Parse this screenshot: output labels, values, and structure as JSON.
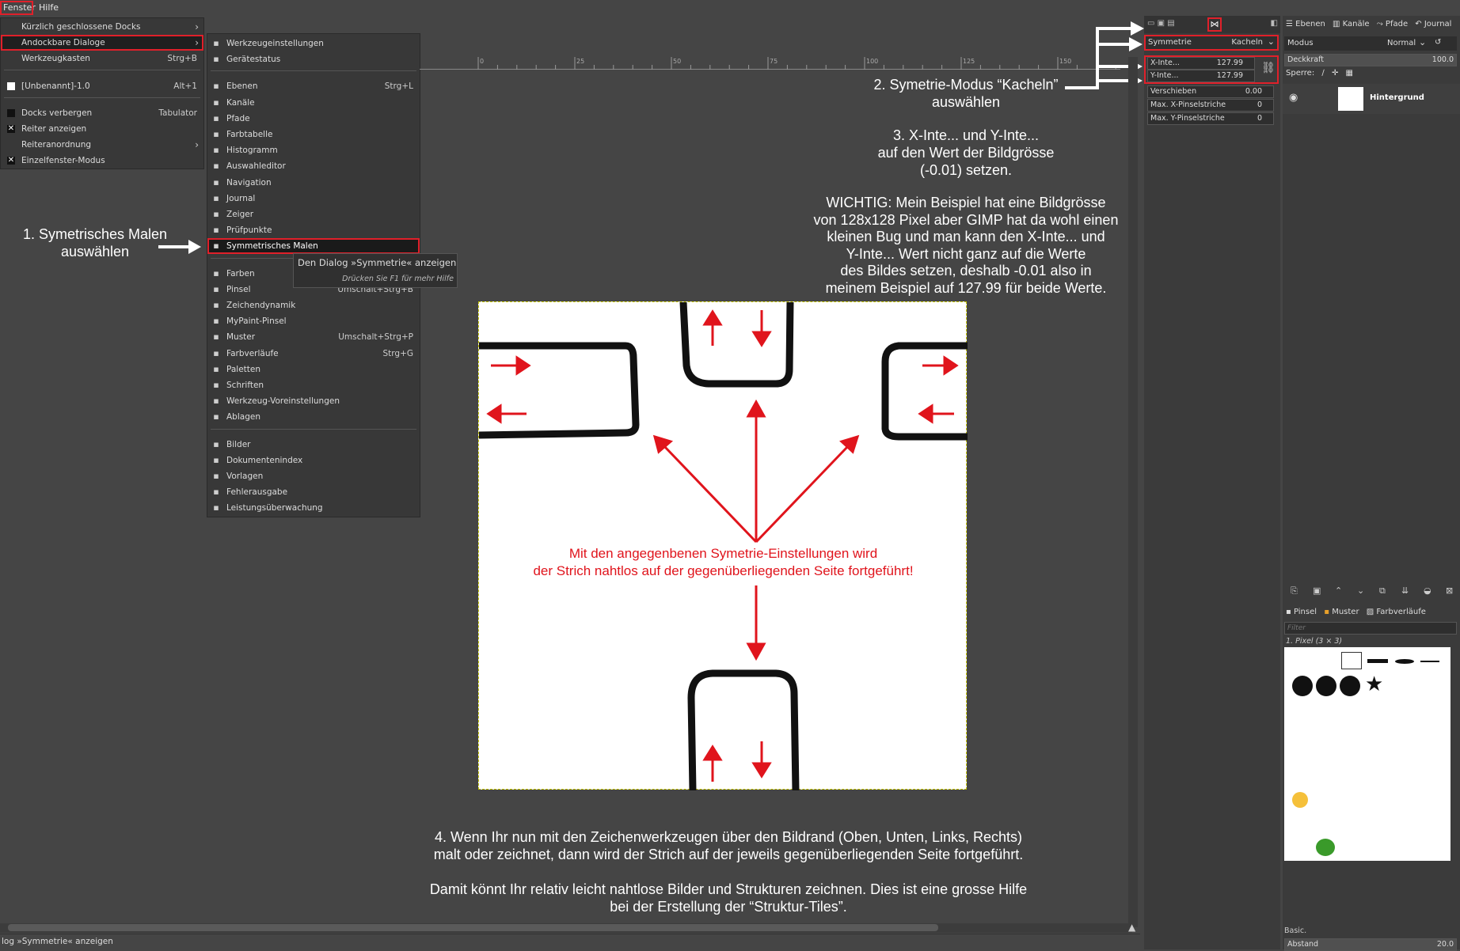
{
  "menubar": {
    "items": [
      "Fenster",
      "Hilfe"
    ]
  },
  "menu_fenster": {
    "items": [
      {
        "label": "Kürzlich geschlossene Docks",
        "shortcut": "",
        "submenu": true
      },
      {
        "label": "Andockbare Dialoge",
        "shortcut": "",
        "submenu": true
      },
      {
        "label": "Werkzeugkasten",
        "shortcut": "Strg+B"
      },
      {
        "label": "[Unbenannt]-1.0",
        "shortcut": "Alt+1"
      },
      {
        "label": "Docks verbergen",
        "shortcut": "Tabulator"
      },
      {
        "label": "Reiter anzeigen",
        "shortcut": ""
      },
      {
        "label": "Reiteranordnung",
        "shortcut": "",
        "submenu": true
      },
      {
        "label": "Einzelfenster-Modus",
        "shortcut": ""
      }
    ]
  },
  "menu_dialoge": {
    "groups": [
      [
        {
          "label": "Werkzeugeinstellungen",
          "shortcut": "",
          "icon": "tool-options-icon"
        },
        {
          "label": "Gerätestatus",
          "shortcut": "",
          "icon": "device-status-icon"
        }
      ],
      [
        {
          "label": "Ebenen",
          "shortcut": "Strg+L",
          "icon": "layers-icon"
        },
        {
          "label": "Kanäle",
          "shortcut": "",
          "icon": "channels-icon"
        },
        {
          "label": "Pfade",
          "shortcut": "",
          "icon": "paths-icon"
        },
        {
          "label": "Farbtabelle",
          "shortcut": "",
          "icon": "colormap-icon"
        },
        {
          "label": "Histogramm",
          "shortcut": "",
          "icon": "histogram-icon"
        },
        {
          "label": "Auswahleditor",
          "shortcut": "",
          "icon": "selection-editor-icon"
        },
        {
          "label": "Navigation",
          "shortcut": "",
          "icon": "navigation-icon"
        },
        {
          "label": "Journal",
          "shortcut": "",
          "icon": "journal-icon"
        },
        {
          "label": "Zeiger",
          "shortcut": "",
          "icon": "pointer-icon"
        },
        {
          "label": "Prüfpunkte",
          "shortcut": "",
          "icon": "sample-points-icon"
        },
        {
          "label": "Symmetrisches Malen",
          "shortcut": "",
          "icon": "symmetry-icon"
        }
      ],
      [
        {
          "label": "Farben",
          "shortcut": "",
          "icon": "colors-icon"
        },
        {
          "label": "Pinsel",
          "shortcut": "Umschalt+Strg+B",
          "icon": "brush-icon"
        },
        {
          "label": "Zeichendynamik",
          "shortcut": "",
          "icon": "dynamics-icon"
        },
        {
          "label": "MyPaint-Pinsel",
          "shortcut": "",
          "icon": "mypaint-brush-icon"
        },
        {
          "label": "Muster",
          "shortcut": "Umschalt+Strg+P",
          "icon": "pattern-icon"
        },
        {
          "label": "Farbverläufe",
          "shortcut": "Strg+G",
          "icon": "gradient-icon"
        },
        {
          "label": "Paletten",
          "shortcut": "",
          "icon": "palette-icon"
        },
        {
          "label": "Schriften",
          "shortcut": "",
          "icon": "fonts-icon"
        },
        {
          "label": "Werkzeug-Voreinstellungen",
          "shortcut": "",
          "icon": "tool-presets-icon"
        },
        {
          "label": "Ablagen",
          "shortcut": "",
          "icon": "buffers-icon"
        }
      ],
      [
        {
          "label": "Bilder",
          "shortcut": "",
          "icon": "images-icon"
        },
        {
          "label": "Dokumentenindex",
          "shortcut": "",
          "icon": "document-history-icon"
        },
        {
          "label": "Vorlagen",
          "shortcut": "",
          "icon": "templates-icon"
        },
        {
          "label": "Fehlerausgabe",
          "shortcut": "",
          "icon": "error-console-icon"
        },
        {
          "label": "Leistungsüberwachung",
          "shortcut": "",
          "icon": "dashboard-icon"
        }
      ]
    ]
  },
  "tooltip": {
    "title": "Den Dialog »Symmetrie« anzeigen",
    "hint": "Drücken Sie F1 für mehr Hilfe"
  },
  "ruler": {
    "ticks": [
      "0",
      "25",
      "50",
      "75",
      "100",
      "125",
      "150"
    ]
  },
  "annotations": {
    "step1": [
      "1. Symetrisches Malen",
      "auswählen"
    ],
    "step2": [
      "2. Symetrie-Modus “Kacheln”",
      "auswählen"
    ],
    "step3": [
      "3. X-Inte... und Y-Inte...",
      "auf den Wert der Bildgrösse",
      "(-0.01) setzen."
    ],
    "wichtig": [
      "WICHTIG: Mein Beispiel hat eine Bildgrösse",
      "von 128x128 Pixel aber GIMP hat da wohl einen",
      "kleinen Bug und man kann den X-Inte... und",
      "Y-Inte... Wert nicht ganz auf die Werte",
      "des Bildes setzen, deshalb -0.01 also in",
      "meinem Beispiel auf 127.99 für beide Werte."
    ],
    "canvas_red": [
      "Mit den angegenbenen Symetrie-Einstellungen wird",
      "der Strich nahtlos auf der gegenüberliegenden Seite fortgeführt!"
    ],
    "step4": [
      "4. Wenn Ihr nun mit den Zeichenwerkzeugen über den Bildrand (Oben, Unten, Links, Rechts)",
      "malt oder zeichnet, dann wird der Strich auf der jeweils gegenüberliegenden Seite fortgeführt."
    ],
    "final": [
      "Damit könnt Ihr relativ leicht nahtlose Bilder und Strukturen zeichnen. Dies ist eine grosse Hilfe",
      "bei der Erstellung der “Struktur-Tiles”."
    ]
  },
  "statusbar": {
    "text": "log »Symmetrie« anzeigen"
  },
  "symmetry_dock": {
    "mode_label": "Symmetrie",
    "mode_value": "Kacheln",
    "fields": [
      {
        "label": "X-Inte...",
        "value": "127.99"
      },
      {
        "label": "Y-Inte...",
        "value": "127.99"
      },
      {
        "label": "Verschieben",
        "value": "0.00"
      },
      {
        "label": "Max. X-Pinselstriche",
        "value": "0"
      },
      {
        "label": "Max. Y-Pinselstriche",
        "value": "0"
      }
    ]
  },
  "layers_dock": {
    "tabs": [
      "Ebenen",
      "Kanäle",
      "Pfade",
      "Journal"
    ],
    "mode_label": "Modus",
    "mode_value": "Normal",
    "opacity_label": "Deckkraft",
    "opacity_value": "100.0",
    "lock_label": "Sperre:",
    "layer_name": "Hintergrund"
  },
  "brushes_dock": {
    "tabs": [
      "Pinsel",
      "Muster",
      "Farbverläufe"
    ],
    "filter_placeholder": "Filter",
    "brush_name": "1. Pixel (3 × 3)",
    "preset": "Basic.",
    "spacing_label": "Abstand",
    "spacing_value": "20.0"
  },
  "colors": {
    "accent_red": "#e0141c",
    "menu_bg": "#383838",
    "app_bg": "#454545"
  }
}
